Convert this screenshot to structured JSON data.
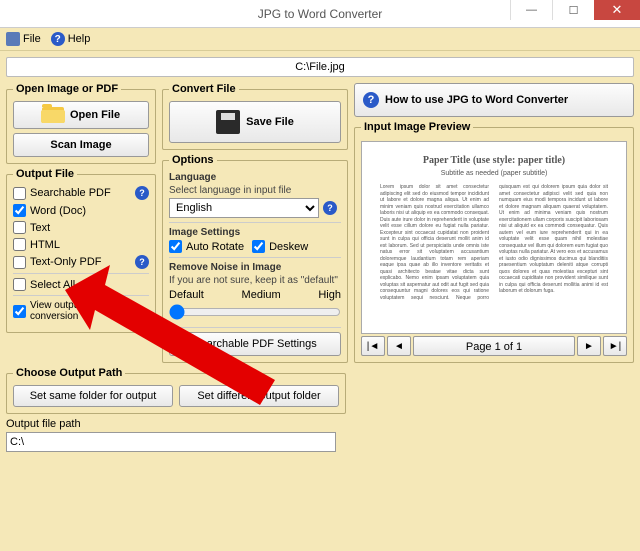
{
  "window": {
    "title": "JPG to Word Converter"
  },
  "menu": {
    "file": "File",
    "help": "Help"
  },
  "filepath": "C:\\File.jpg",
  "open_group": {
    "legend": "Open Image or PDF",
    "open_file": "Open File",
    "scan_image": "Scan Image"
  },
  "convert_group": {
    "legend": "Convert File",
    "save_file": "Save File"
  },
  "output_file": {
    "legend": "Output File",
    "searchable_pdf": "Searchable PDF",
    "word_doc": "Word (Doc)",
    "text": "Text",
    "html": "HTML",
    "text_only_pdf": "Text-Only PDF",
    "select_all": "Select All",
    "view_output": "View output files after conversion"
  },
  "options": {
    "legend": "Options",
    "language_label": "Language",
    "language_desc": "Select language in input file",
    "language_value": "English",
    "image_settings_label": "Image Settings",
    "auto_rotate": "Auto Rotate",
    "deskew": "Deskew",
    "noise_label": "Remove Noise in Image",
    "noise_desc": "If you are not sure, keep it as \"default\"",
    "noise_default": "Default",
    "noise_medium": "Medium",
    "noise_high": "High",
    "searchable_pdf_settings": "Searchable PDF Settings"
  },
  "howto": "How to use JPG to Word Converter",
  "preview": {
    "legend": "Input Image Preview",
    "paper_title": "Paper Title (use style: paper title)",
    "paper_subtitle": "Subtitle as needed (paper subtitle)",
    "pager": "Page 1 of 1"
  },
  "choose_path": {
    "legend": "Choose Output Path",
    "same_folder": "Set same folder for output",
    "diff_folder": "Set different output folder"
  },
  "output_path_label": "Output file path",
  "output_path_value": "C:\\"
}
